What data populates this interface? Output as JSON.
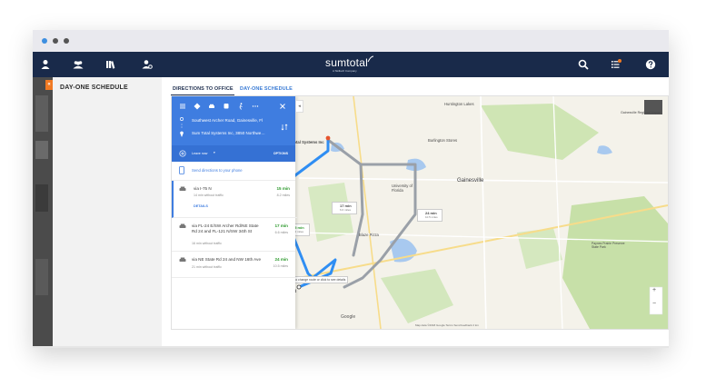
{
  "app": {
    "logo": "sumtotal",
    "logo_sub": "A Skillsoft Company",
    "panel_title": "DAY-ONE SCHEDULE",
    "collapse_glyph": "«"
  },
  "tabs": [
    {
      "label": "DIRECTIONS TO OFFICE",
      "active": true
    },
    {
      "label": "DAY-ONE SCHEDULE",
      "active": false
    }
  ],
  "directions": {
    "origin": "Southwest Archer Road, Gainesville, Fl",
    "destination": "Sum Total Systems Inc, 3850 Northwe…",
    "leave_now": "Leave now",
    "options": "OPTIONS",
    "send_to_phone": "Send directions to your phone",
    "details": "DETAILS",
    "routes": [
      {
        "via": "via I-75 N",
        "traffic": "14 min without traffic",
        "time": "15 min",
        "distance": "8.2 miles"
      },
      {
        "via": "via FL-24 E/SW Archer Rd/NE State Rd 24 and FL-121 N/SW 34th St",
        "traffic": "16 min without traffic",
        "time": "17 min",
        "distance": "6.6 miles"
      },
      {
        "via": "via NE State Rd 24 and NW 16th Ave",
        "traffic": "21 min without traffic",
        "time": "24 min",
        "distance": "10.5 miles"
      }
    ]
  },
  "map": {
    "labels": {
      "huntington": "Huntington Lakes",
      "sumtotal": "Sum Total Systems Inc",
      "burlington": "Burlington Stores",
      "gainesville_airport": "Gainesville Regional Airport",
      "gainesville": "Gainesville",
      "university": "University of Florida",
      "blaze": "Blaze Pizza",
      "archer": "Southwest Archer Road",
      "drag_hint": "Drag to change route or click to see details",
      "paynes": "Paynes Prairie Preserve State Park",
      "google": "Google",
      "earth": "Earth",
      "attribution": "Map data ©2018 Google   Terms   Send feedback   2 km"
    },
    "bubbles": {
      "r1_time": "15 min",
      "r1_dist": "8.2 miles",
      "r2_time": "17 min",
      "r2_dist": "6.6 miles",
      "r3_time": "24 min",
      "r3_dist": "10.5 miles"
    },
    "zoom_in": "+",
    "zoom_out": "−"
  },
  "colors": {
    "topbar": "#192a4a",
    "accent_orange": "#f07a23",
    "route_blue": "#2f8ef3",
    "route_gray": "#9aa0a8",
    "directions_header": "#3f7de0"
  },
  "icons": [
    "person-icon",
    "group-icon",
    "library-icon",
    "user-settings-icon",
    "search-icon",
    "tasks-icon",
    "help-icon"
  ]
}
